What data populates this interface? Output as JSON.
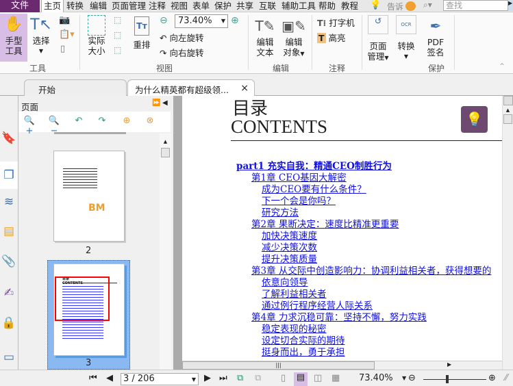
{
  "menu": {
    "file": "文件",
    "tabs": [
      "主页",
      "转换",
      "编辑",
      "页面管理",
      "注释",
      "视图",
      "表单",
      "保护",
      "共享",
      "互联",
      "辅助工具",
      "帮助",
      "教程"
    ],
    "tell": "告诉",
    "search_placeholder": "查找"
  },
  "ribbon": {
    "hand": [
      "手型",
      "工具"
    ],
    "select": "选择",
    "tools_group": "工具",
    "actual": [
      "实际",
      "大小"
    ],
    "reflow": "重排",
    "zoom_value": "73.40%",
    "rotate_left": "向左旋转",
    "rotate_right": "向右旋转",
    "view_group": "视图",
    "edit_text": [
      "编辑",
      "文本"
    ],
    "edit_obj": [
      "编辑",
      "对象"
    ],
    "edit_group": "编辑",
    "typewriter": "打字机",
    "highlight": "高亮",
    "comment_group": "注释",
    "page_mgmt": [
      "页面",
      "管理"
    ],
    "convert": "转换",
    "pdf_sign": [
      "PDF",
      "签名"
    ],
    "protect_group": "保护"
  },
  "tabs": {
    "start": "开始",
    "doc": "为什么精英都有超级领...",
    "close": "×"
  },
  "panel": {
    "title": "页面",
    "thumbs": [
      {
        "label": "2"
      },
      {
        "label": "3"
      }
    ]
  },
  "doc": {
    "title_cn": "目录",
    "title_en": "CONTENTS",
    "toc": [
      {
        "level": 0,
        "text": "part1 充实自我：精通CEO制胜行为"
      },
      {
        "level": 1,
        "text": "第1章 CEO基因大解密"
      },
      {
        "level": 2,
        "text": "成为CEO要有什么条件？"
      },
      {
        "level": 2,
        "text": "下一个会是你吗？"
      },
      {
        "level": 2,
        "text": "研究方法"
      },
      {
        "level": 1,
        "text": "第2章 果断决定：速度比精准更重要"
      },
      {
        "level": 2,
        "text": "加快决策速度"
      },
      {
        "level": 2,
        "text": "减少决策次数"
      },
      {
        "level": 2,
        "text": "提升决策质量"
      },
      {
        "level": 1,
        "text": "第3章 从交际中创造影响力：协调利益相关者，获得想要的"
      },
      {
        "level": 2,
        "text": "依意向领导"
      },
      {
        "level": 2,
        "text": "了解利益相关者"
      },
      {
        "level": 2,
        "text": "通过例行程序经营人际关系"
      },
      {
        "level": 1,
        "text": "第4章 力求沉稳可靠：坚持不懈，努力实践"
      },
      {
        "level": 2,
        "text": "稳定表现的秘密"
      },
      {
        "level": 2,
        "text": "设定切合实际的期待"
      },
      {
        "level": 2,
        "text": "挺身而出，勇于承担"
      }
    ]
  },
  "status": {
    "page": "3 / 206",
    "zoom": "73.40%",
    "zoom_fraction": 0.5
  },
  "colors": {
    "accent": "#6b2a70",
    "link": "#1010e0"
  }
}
